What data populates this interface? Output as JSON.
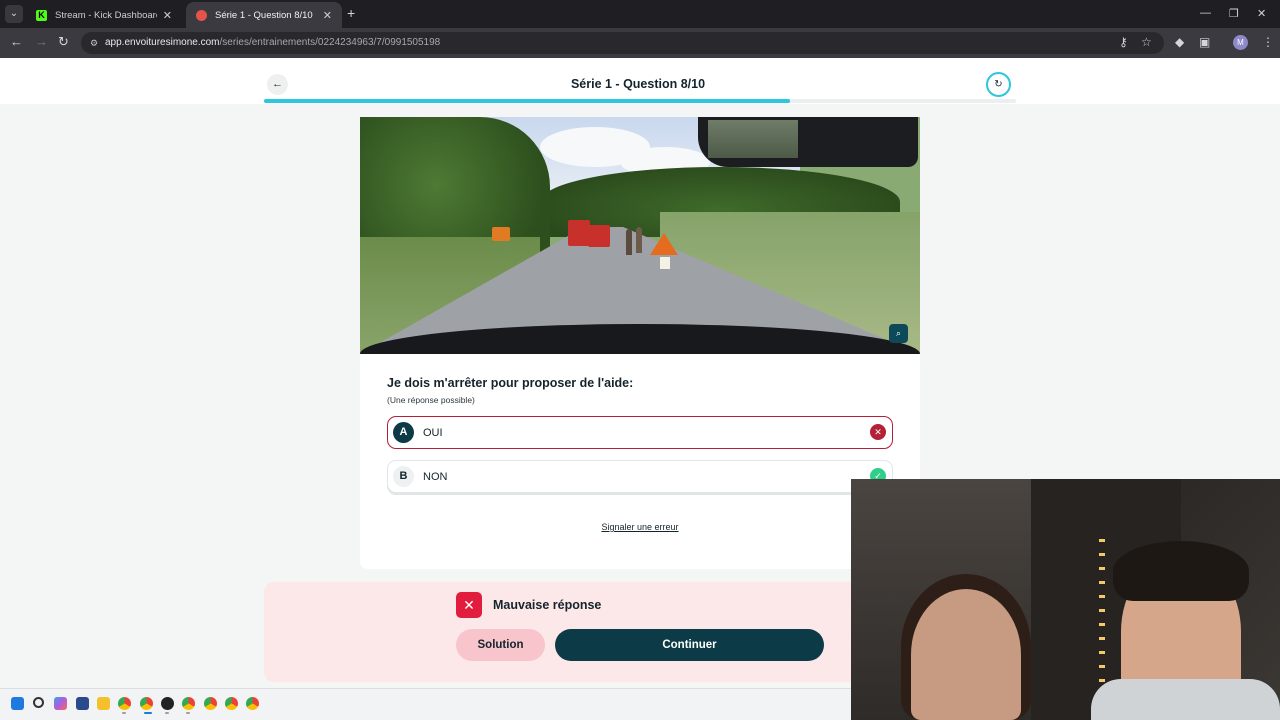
{
  "browser": {
    "tabs": [
      {
        "title": "Stream - Kick Dashboard",
        "favicon": "kick-icon"
      },
      {
        "title": "Série 1 - Question 8/10",
        "favicon": "site-icon",
        "active": true
      }
    ],
    "url_host": "app.envoituresimone.com",
    "url_path": "/series/entrainements/0224234963/7/0991505198"
  },
  "page": {
    "title": "Série 1 - Question 8/10",
    "progress": 0.7
  },
  "question": {
    "text": "Je dois m'arrêter pour proposer de l'aide:",
    "hint": "(Une réponse possible)",
    "answers": [
      {
        "letter": "A",
        "label": "OUI",
        "state": "wrong"
      },
      {
        "letter": "B",
        "label": "NON",
        "state": "correct"
      }
    ],
    "report_link": "Signaler une erreur"
  },
  "feedback": {
    "message": "Mauvaise réponse",
    "solution_label": "Solution",
    "continue_label": "Continuer"
  },
  "colors": {
    "accent": "#2cc7de",
    "primary": "#0c3a46",
    "error": "#e11c3c",
    "success": "#2fce8b"
  }
}
